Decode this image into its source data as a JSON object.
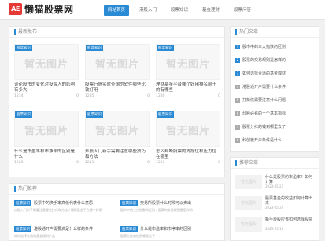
{
  "header": {
    "logo_mark": "AE",
    "site_name": "懒猫股票网",
    "nav": [
      "网站首页",
      "港股入门",
      "股票知识",
      "基金理财",
      "股票问答"
    ]
  },
  "latest": {
    "title": "最新发布",
    "badge": "股票知识",
    "noimg": "暂无图片",
    "cards": [
      {
        "title": "谈论股市的变化对投资人的影响有多大",
        "views": "1234",
        "comments": "0"
      },
      {
        "title": "股票行情实时查询的软件哪些比较好用",
        "views": "1235",
        "comments": "0"
      },
      {
        "title": "理财基金平台哪个好用排名前十的有哪些",
        "views": "1230",
        "comments": "0"
      },
      {
        "title": "什么是市盈率和市净率的区别是什么",
        "views": "1220",
        "comments": "0"
      },
      {
        "title": "炒股入门新手需要注意哪些技巧和方法",
        "views": "1211",
        "comments": "0"
      },
      {
        "title": "怎么判断股票的支撑位和压力位在哪里",
        "views": "1222",
        "comments": "0"
      }
    ]
  },
  "hot": {
    "title": "热门文章",
    "items": [
      "股市中的三大指数的区别",
      "股票的交易规则是怎样的",
      "如何选择合适的基金理财",
      "港股通开户需要什么条件",
      "打新债需要注意什么问题",
      "炒股必看的十个基本指标",
      "股票分红的钱到哪里去了",
      "科创板开户条件是什么"
    ]
  },
  "recommend": {
    "title": "推荐文章",
    "noimg": "暂无图片",
    "items": [
      {
        "title": "什么是股票的市盈率？如何计算",
        "date": "2023-05-21"
      },
      {
        "title": "股票基金的收益如何计算出来",
        "date": "2023-05-20"
      },
      {
        "title": "新手炒股应该如何选择股票",
        "date": "2023-05-18"
      }
    ]
  },
  "bottom": {
    "title": "热门推荐",
    "rows": [
      {
        "tag": "股票知识",
        "title": "股票中的换手率高低代表什么意思",
        "sub": "炒股入门新手需要注意哪些技巧和方法 / 理财基金平台哪个好用"
      },
      {
        "tag": "股票知识",
        "title": "交易所股票什么时候可以卖出",
        "sub": "股市中的三大指数的区别 / 股票的交易规则是怎样的"
      },
      {
        "tag": "股票知识",
        "title": "港股通开户需要满足什么样的条件",
        "sub": "如何选择合适的基金理财产品"
      },
      {
        "tag": "股票知识",
        "title": "什么是市盈率和市净率的区别",
        "sub": "股票分红的钱到哪里去了"
      }
    ]
  }
}
